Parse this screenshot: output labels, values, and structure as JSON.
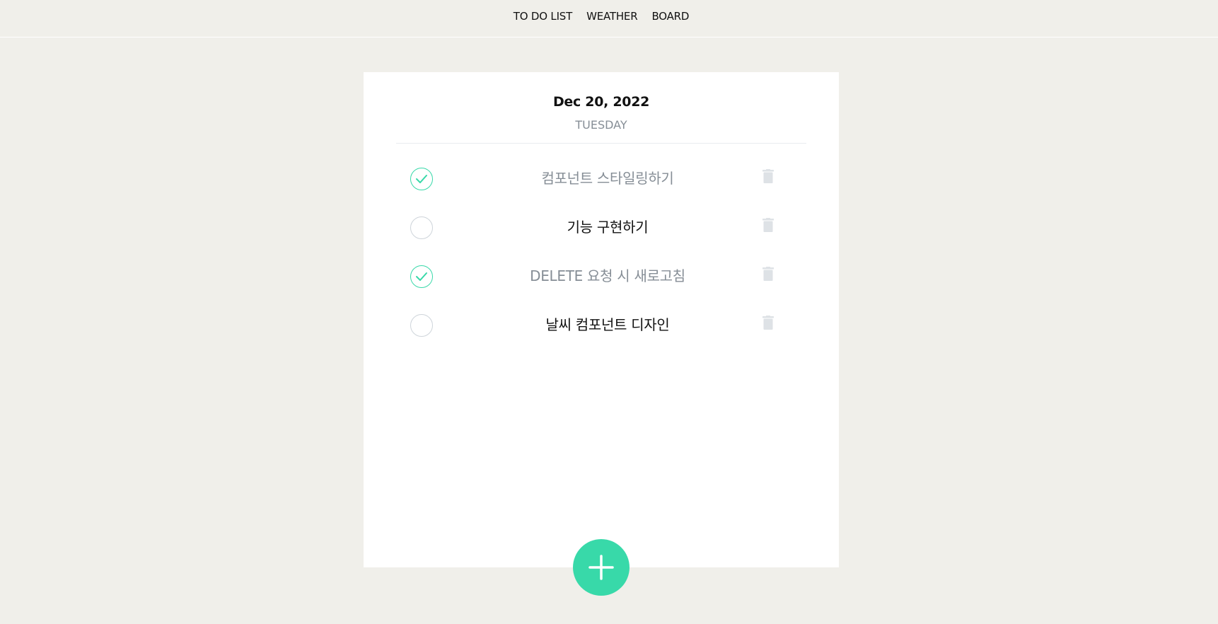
{
  "nav": {
    "links": [
      "TO DO LIST",
      "WEATHER",
      "BOARD"
    ]
  },
  "header": {
    "date": "Dec 20, 2022",
    "day": "TUESDAY"
  },
  "todos": [
    {
      "text": "컴포넌트 스타일링하기",
      "done": true
    },
    {
      "text": "기능 구현하기",
      "done": false
    },
    {
      "text": "DELETE 요청 시 새로고침",
      "done": true
    },
    {
      "text": "날씨 컴포넌트 디자인",
      "done": false
    }
  ],
  "icons": {
    "check": "check-icon",
    "trash": "trash-icon",
    "add": "plus-icon"
  },
  "colors": {
    "accent": "#38d9a9",
    "done_text": "#868e96",
    "trash": "#dee2e6",
    "background": "#f0efea"
  }
}
